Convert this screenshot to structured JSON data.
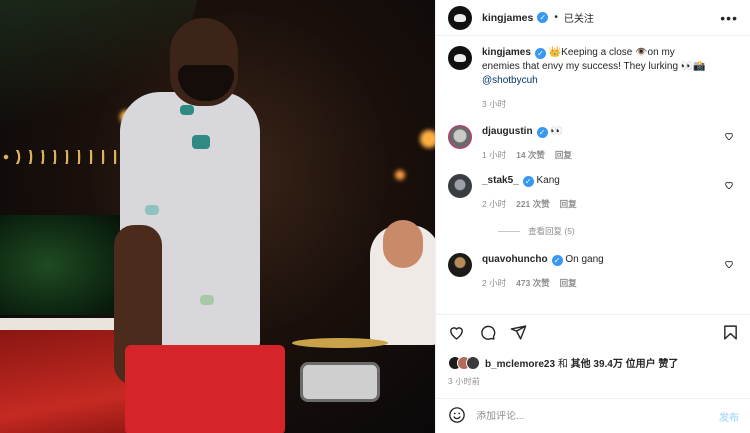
{
  "header": {
    "username": "kingjames",
    "separator": "•",
    "follow_status": "已关注",
    "more": "•••"
  },
  "caption": {
    "username": "kingjames",
    "text": "👑Keeping a close 👁️on my enemies that envy my success! They lurking 👀📸",
    "mention": "@shotbycuh",
    "time": "3 小时"
  },
  "comments": [
    {
      "username": "djaugustin",
      "text": "👀",
      "time": "1 小时",
      "likes": "14 次赞",
      "reply": "回复"
    },
    {
      "username": "_stak5_",
      "text": "Kang",
      "time": "2 小时",
      "likes": "221 次赞",
      "reply": "回复",
      "view_replies": "查看回复 (5)"
    },
    {
      "username": "quavohuncho",
      "text": "On gang",
      "time": "2 小时",
      "likes": "473 次赞",
      "reply": "回复"
    }
  ],
  "likes": {
    "text_prefix": "b_mclemore23",
    "text_mid": " 和 ",
    "text_suffix": "其他 39.4万 位用户 赞了"
  },
  "post_time": "3 小时前",
  "comment_box": {
    "placeholder": "添加评论...",
    "publish": "发布"
  },
  "colors": {
    "verified": "#3897f0",
    "mention": "#00376b",
    "muted": "#8e8e8e",
    "publish_disabled": "#b2dffc"
  },
  "icons": [
    "heart-icon",
    "comment-icon",
    "share-icon",
    "bookmark-icon",
    "emoji-icon",
    "verified-icon",
    "more-icon"
  ]
}
